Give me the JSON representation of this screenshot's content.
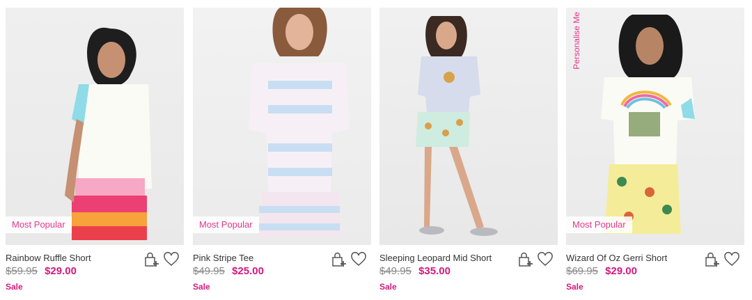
{
  "products": [
    {
      "name": "Rainbow Ruffle Short",
      "was_price": "$59.95",
      "price": "$29.00",
      "sale_label": "Sale",
      "badge": "Most Popular",
      "overlay_text": ""
    },
    {
      "name": "Pink Stripe Tee",
      "was_price": "$49.95",
      "price": "$25.00",
      "sale_label": "Sale",
      "badge": "Most Popular",
      "overlay_text": ""
    },
    {
      "name": "Sleeping Leopard Mid Short",
      "was_price": "$49.95",
      "price": "$35.00",
      "sale_label": "Sale",
      "badge": "",
      "overlay_text": ""
    },
    {
      "name": "Wizard Of Oz Gerri Short",
      "was_price": "$69.95",
      "price": "$29.00",
      "sale_label": "Sale",
      "badge": "Most Popular",
      "overlay_text": "Personalise Me"
    }
  ],
  "icons": {
    "add_to_bag": "bag-plus-icon",
    "wishlist": "heart-icon"
  },
  "colors": {
    "accent": "#e2378b",
    "sale_price": "#d4197e",
    "was_price": "#888888"
  }
}
